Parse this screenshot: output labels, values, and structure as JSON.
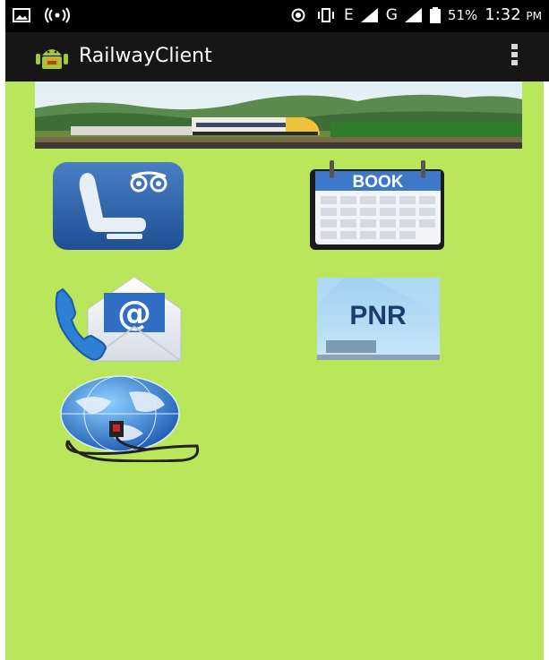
{
  "status_bar": {
    "signal_text": "E",
    "network_text": "G",
    "battery": "51%",
    "time": "1:32",
    "ampm": "PM"
  },
  "app_bar": {
    "title": "RailwayClient",
    "icon": "android-icon",
    "menu_icon": "overflow-menu-icon"
  },
  "banner": {
    "icon": "train-landscape-banner"
  },
  "tiles": [
    {
      "name": "seat-availability",
      "icon": "seat-icon"
    },
    {
      "name": "book-ticket",
      "icon": "book-calendar-icon",
      "label": "BOOK"
    },
    {
      "name": "contact-us",
      "icon": "phone-mail-icon",
      "label": "@"
    },
    {
      "name": "pnr-status",
      "icon": "pnr-icon",
      "label": "PNR"
    },
    {
      "name": "internet",
      "icon": "globe-network-icon"
    }
  ],
  "colors": {
    "background": "#b9e65b",
    "app_bar": "#161616",
    "status_bar": "#000000"
  }
}
